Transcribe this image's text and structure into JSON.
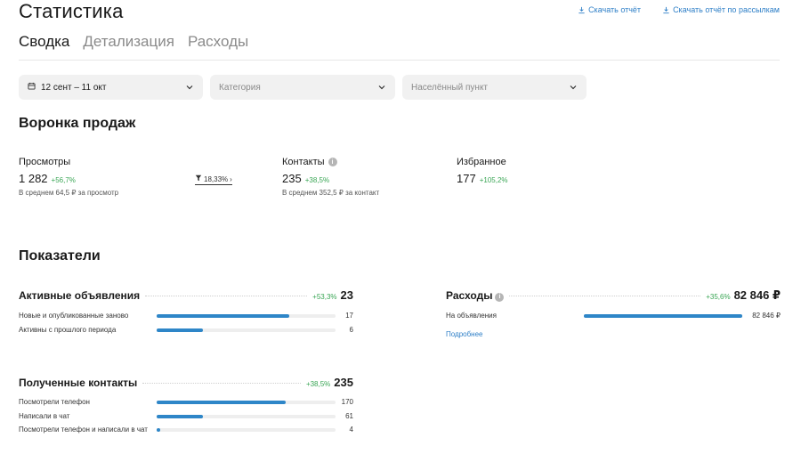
{
  "page": {
    "title": "Статистика"
  },
  "downloads": [
    {
      "label": "Скачать отчёт",
      "icon": "download-icon"
    },
    {
      "label": "Скачать отчёт по рассылкам",
      "icon": "download-icon"
    }
  ],
  "tabs": [
    {
      "label": "Сводка",
      "active": true
    },
    {
      "label": "Детализация",
      "active": false
    },
    {
      "label": "Расходы",
      "active": false
    }
  ],
  "filters": {
    "period": {
      "value": "12 сент – 11 окт",
      "icon": "calendar-icon"
    },
    "category": {
      "placeholder": "Категория"
    },
    "city": {
      "placeholder": "Населённый пункт"
    }
  },
  "funnel": {
    "title": "Воронка продаж",
    "views": {
      "label": "Просмотры",
      "value": "1 282",
      "delta": "+56,7%",
      "sub": "В среднем 64,5 ₽ за просмотр"
    },
    "conversion": {
      "value": "18,33%",
      "icon": "funnel-icon"
    },
    "contacts": {
      "label": "Контакты",
      "value": "235",
      "delta": "+38,5%",
      "sub": "В среднем 352,5 ₽ за контакт"
    },
    "favorites": {
      "label": "Избранное",
      "value": "177",
      "delta": "+105,2%"
    }
  },
  "indicators": {
    "title": "Показатели",
    "active_ads": {
      "title": "Активные объявления",
      "delta": "+53,3%",
      "total": "23",
      "rows": [
        {
          "label": "Новые и опубликованные заново",
          "value": "17",
          "fraction": 0.74
        },
        {
          "label": "Активны с прошлого периода",
          "value": "6",
          "fraction": 0.26
        }
      ]
    },
    "contacts": {
      "title": "Полученные контакты",
      "delta": "+38,5%",
      "total": "235",
      "rows": [
        {
          "label": "Посмотрели телефон",
          "value": "170",
          "fraction": 0.72
        },
        {
          "label": "Написали в чат",
          "value": "61",
          "fraction": 0.26
        },
        {
          "label": "Посмотрели телефон и написали в чат",
          "value": "4",
          "fraction": 0.02
        }
      ]
    },
    "expenses": {
      "title": "Расходы",
      "delta": "+35,6%",
      "total": "82 846 ₽",
      "rows": [
        {
          "label": "На объявления",
          "value": "82 846 ₽",
          "fraction": 1.0
        }
      ],
      "more_label": "Подробнее"
    }
  },
  "colors": {
    "accent": "#2e86c8",
    "link": "#2e7fc7",
    "positive": "#3aa655"
  }
}
